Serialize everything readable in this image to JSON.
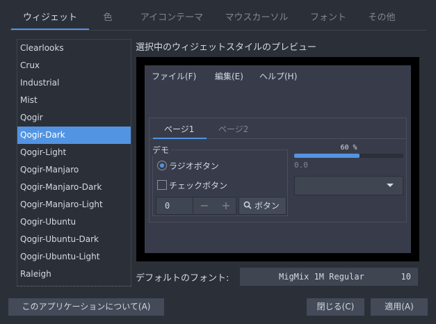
{
  "tabs": [
    {
      "label": "ウィジェット",
      "active": true
    },
    {
      "label": "色"
    },
    {
      "label": "アイコンテーマ"
    },
    {
      "label": "マウスカーソル"
    },
    {
      "label": "フォント"
    },
    {
      "label": "その他"
    }
  ],
  "themes": {
    "items": [
      "Clearlooks",
      "Crux",
      "Industrial",
      "Mist",
      "Qogir",
      "Qogir-Dark",
      "Qogir-Light",
      "Qogir-Manjaro",
      "Qogir-Manjaro-Dark",
      "Qogir-Manjaro-Light",
      "Qogir-Ubuntu",
      "Qogir-Ubuntu-Dark",
      "Qogir-Ubuntu-Light",
      "Raleigh"
    ],
    "selected": "Qogir-Dark"
  },
  "preview": {
    "label": "選択中のウィジェットスタイルのプレビュー",
    "menu": [
      "ファイル(F)",
      "編集(E)",
      "ヘルプ(H)"
    ],
    "notebook_tabs": [
      "ページ1",
      "ページ2"
    ],
    "frame_label": "デモ",
    "radio_label": "ラジオボタン",
    "check_label": "チェックボタン",
    "spin_value": "0",
    "spin_minus": "−",
    "spin_plus": "+",
    "search_button": "ボタン",
    "progress_text": "60 %",
    "progress_fraction": 0.6,
    "scale_value": "0.0"
  },
  "font": {
    "label": "デフォルトのフォント:",
    "name": "MigMix 1M Regular",
    "size": "10"
  },
  "buttons": {
    "about": "このアプリケーションについて(A)",
    "close": "閉じる(C)",
    "apply": "適用(A)"
  },
  "colors": {
    "accent": "#5294e2",
    "background": "#2b3038",
    "preview_bg": "#383c4a"
  }
}
